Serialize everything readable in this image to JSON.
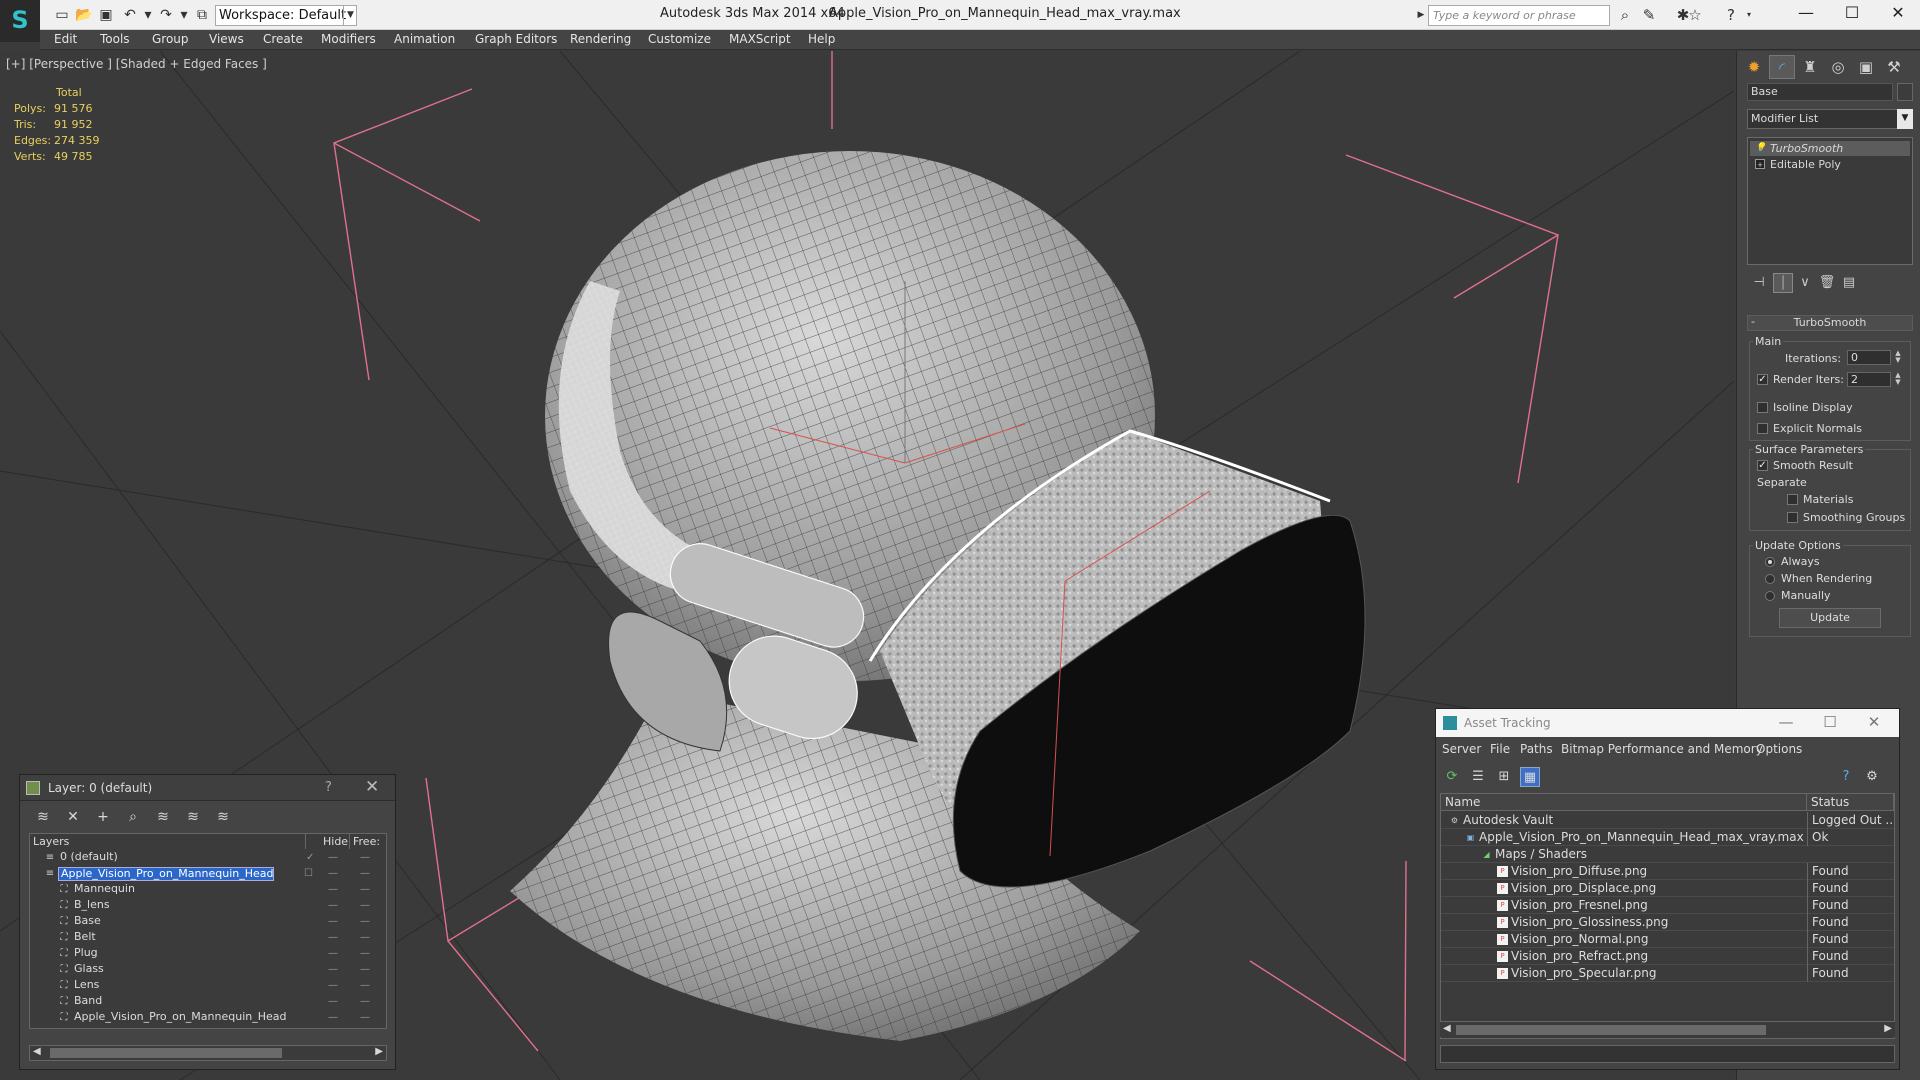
{
  "titlebar": {
    "workspace": "Workspace: Default",
    "app_title": "Autodesk 3ds Max  2014 x64",
    "file_title": "Apple_Vision_Pro_on_Mannequin_Head_max_vray.max",
    "search_placeholder": "Type a keyword or phrase"
  },
  "menu": [
    "Edit",
    "Tools",
    "Group",
    "Views",
    "Create",
    "Modifiers",
    "Animation",
    "Graph Editors",
    "Rendering",
    "Customize",
    "MAXScript",
    "Help"
  ],
  "viewport": {
    "label": "[+] [Perspective ] [Shaded + Edged Faces ]",
    "stats": {
      "header": "Total",
      "polys_label": "Polys:",
      "polys": "91 576",
      "tris_label": "Tris:",
      "tris": "91 952",
      "edges_label": "Edges:",
      "edges": "274 359",
      "verts_label": "Verts:",
      "verts": "49 785"
    }
  },
  "command_panel": {
    "object_name": "Base",
    "modifier_list": "Modifier List",
    "stack": [
      "TurboSmooth",
      "Editable Poly"
    ],
    "rollout_title": "TurboSmooth",
    "main_group": "Main",
    "iterations_label": "Iterations:",
    "iterations_value": "0",
    "render_iters_label": "Render Iters:",
    "render_iters_value": "2",
    "isoline_label": "Isoline Display",
    "explicit_normals_label": "Explicit Normals",
    "surface_group": "Surface Parameters",
    "smooth_result_label": "Smooth Result",
    "separate_label": "Separate",
    "materials_label": "Materials",
    "smoothing_groups_label": "Smoothing Groups",
    "update_group": "Update Options",
    "always_label": "Always",
    "when_rendering_label": "When Rendering",
    "manually_label": "Manually",
    "update_button": "Update"
  },
  "layers": {
    "title": "Layer: 0 (default)",
    "help": "?",
    "col_layers": "Layers",
    "col_hide": "Hide",
    "col_freeze": "Free:",
    "rows": [
      {
        "name": "0 (default)",
        "indent": 0,
        "selected": false
      },
      {
        "name": "Apple_Vision_Pro_on_Mannequin_Head",
        "indent": 0,
        "selected": true
      },
      {
        "name": "Mannequin",
        "indent": 1,
        "selected": false
      },
      {
        "name": "B_lens",
        "indent": 1,
        "selected": false
      },
      {
        "name": "Base",
        "indent": 1,
        "selected": false
      },
      {
        "name": "Belt",
        "indent": 1,
        "selected": false
      },
      {
        "name": "Plug",
        "indent": 1,
        "selected": false
      },
      {
        "name": "Glass",
        "indent": 1,
        "selected": false
      },
      {
        "name": "Lens",
        "indent": 1,
        "selected": false
      },
      {
        "name": "Band",
        "indent": 1,
        "selected": false
      },
      {
        "name": "Apple_Vision_Pro_on_Mannequin_Head",
        "indent": 1,
        "selected": false
      }
    ]
  },
  "asset_tracking": {
    "title": "Asset Tracking",
    "menu": [
      "Server",
      "File",
      "Paths",
      "Bitmap Performance and Memory",
      "Options"
    ],
    "col_name": "Name",
    "col_status": "Status",
    "rows": [
      {
        "name": "Autodesk Vault",
        "status": "Logged Out ...",
        "level": 0,
        "icon": "vault-icon"
      },
      {
        "name": "Apple_Vision_Pro_on_Mannequin_Head_max_vray.max",
        "status": "Ok",
        "level": 1,
        "icon": "max-file-icon"
      },
      {
        "name": "Maps / Shaders",
        "status": "",
        "level": 2,
        "icon": "maps-icon"
      },
      {
        "name": "Vision_pro_Diffuse.png",
        "status": "Found",
        "level": 3,
        "icon": "png-icon"
      },
      {
        "name": "Vision_pro_Displace.png",
        "status": "Found",
        "level": 3,
        "icon": "png-icon"
      },
      {
        "name": "Vision_pro_Fresnel.png",
        "status": "Found",
        "level": 3,
        "icon": "png-icon"
      },
      {
        "name": "Vision_pro_Glossiness.png",
        "status": "Found",
        "level": 3,
        "icon": "png-icon"
      },
      {
        "name": "Vision_pro_Normal.png",
        "status": "Found",
        "level": 3,
        "icon": "png-icon"
      },
      {
        "name": "Vision_pro_Refract.png",
        "status": "Found",
        "level": 3,
        "icon": "png-icon"
      },
      {
        "name": "Vision_pro_Specular.png",
        "status": "Found",
        "level": 3,
        "icon": "png-icon"
      }
    ]
  },
  "colors": {
    "selection_blue": "#2b66c9",
    "stats_yellow": "#e8d060",
    "bbox_pink": "#e0708c",
    "viewport_bg": "#3a3a3a"
  }
}
